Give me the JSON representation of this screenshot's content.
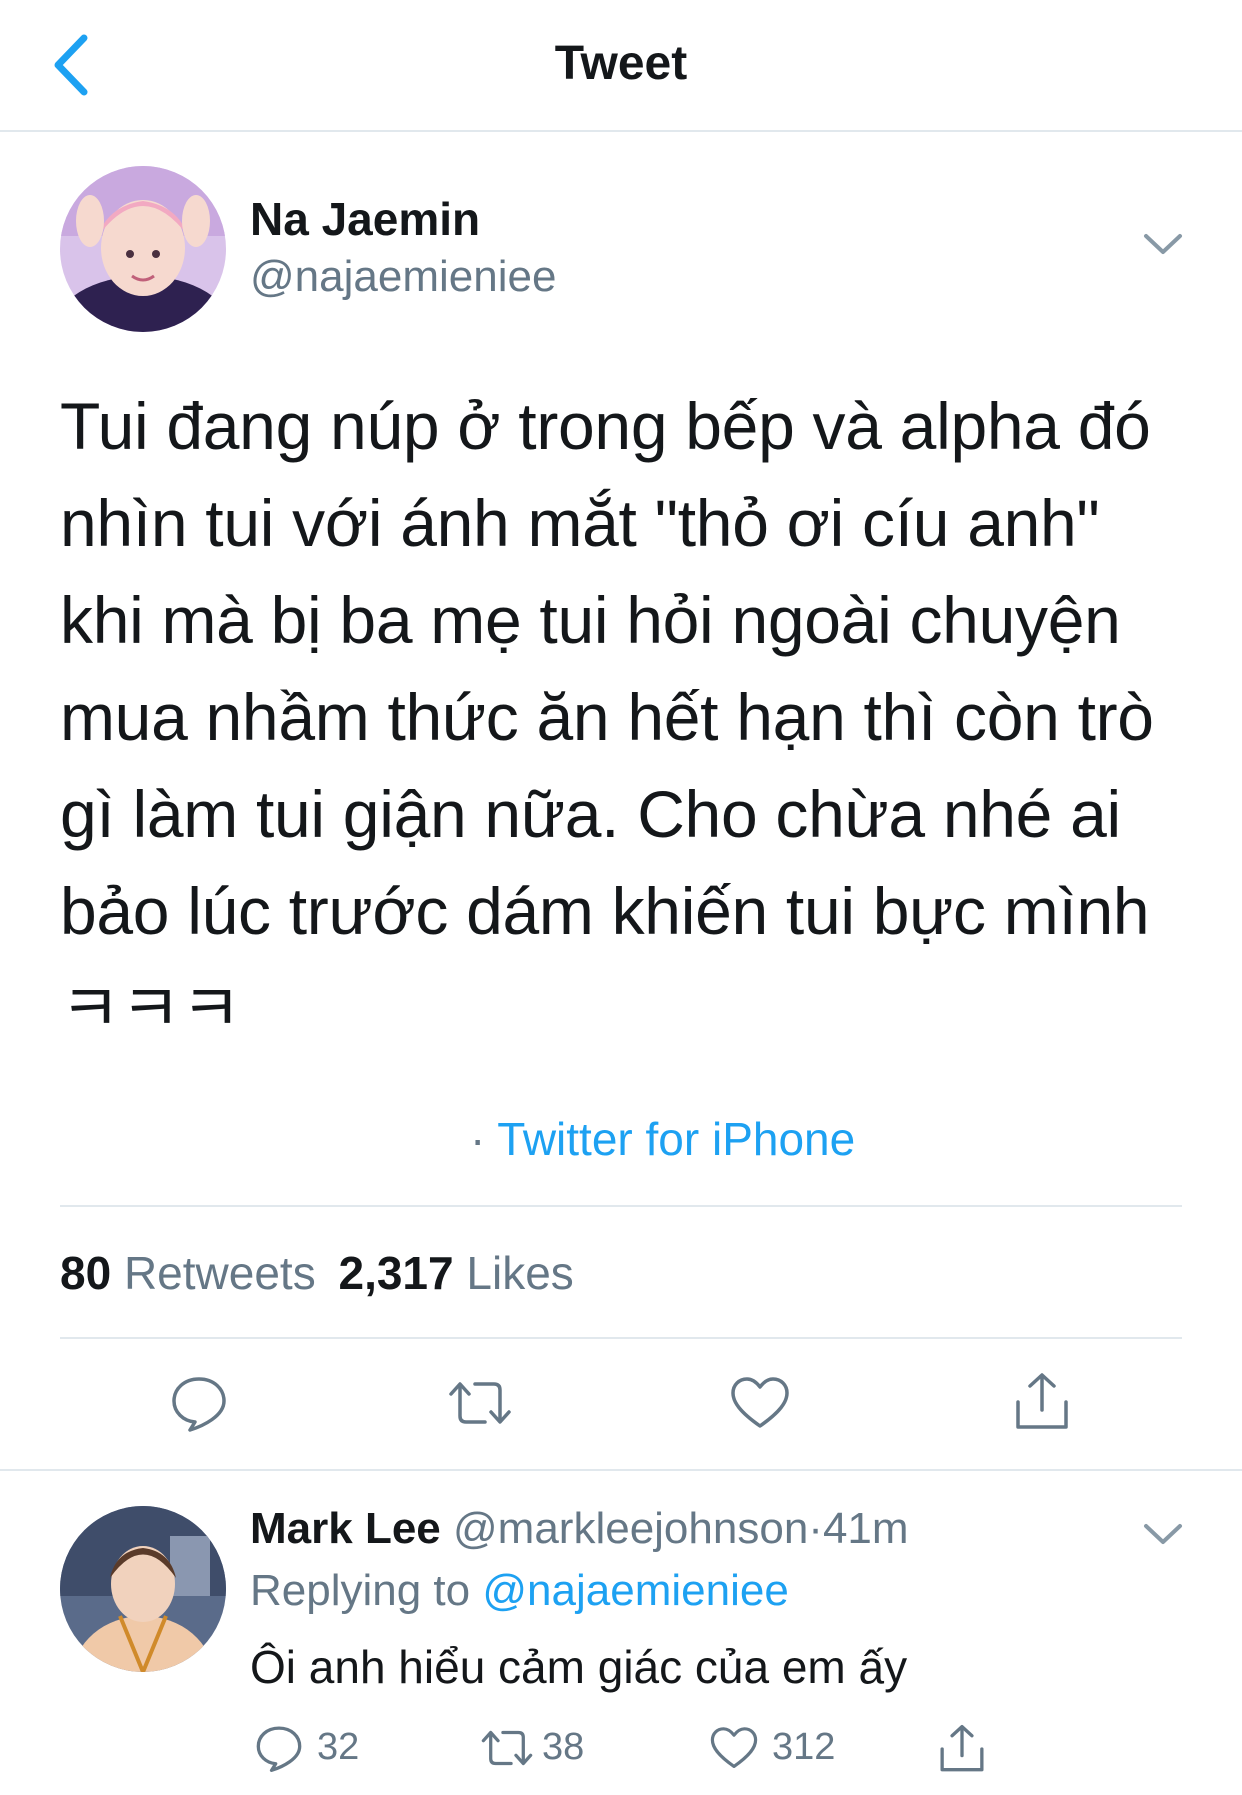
{
  "header": {
    "title": "Tweet"
  },
  "tweet": {
    "author_name": "Na Jaemin",
    "author_handle": "@najaemieniee",
    "text": "Tui đang núp ở trong bếp và alpha đó nhìn tui với ánh mắt \"thỏ ơi cíu anh\" khi mà bị ba mẹ tui hỏi ngoài chuyện mua nhầm thức ăn hết hạn thì còn trò gì làm tui giận nữa. Cho chừa nhé ai bảo lúc trước dám khiến tui bực mình ㅋㅋㅋ",
    "source_dot": "·",
    "source": "Twitter for iPhone",
    "retweet_count": "80",
    "retweet_label": "Retweets",
    "like_count": "2,317",
    "like_label": "Likes"
  },
  "reply": {
    "author_name": "Mark Lee",
    "author_handle": "@markleejohnson",
    "separator": "·",
    "time": "41m",
    "replying_prefix": "Replying to",
    "replying_to": "@najaemieniee",
    "text": "Ôi anh hiểu cảm giác của em ấy",
    "reply_count": "32",
    "retweet_count": "38",
    "like_count": "312"
  },
  "icons": [
    "back-chevron-icon",
    "chevron-down-icon",
    "reply-icon",
    "retweet-icon",
    "like-icon",
    "share-icon"
  ],
  "colors": {
    "accent": "#1da1f2",
    "text": "#14171a",
    "muted": "#657786",
    "divider": "#e1e8ed",
    "icon": "#657786"
  }
}
